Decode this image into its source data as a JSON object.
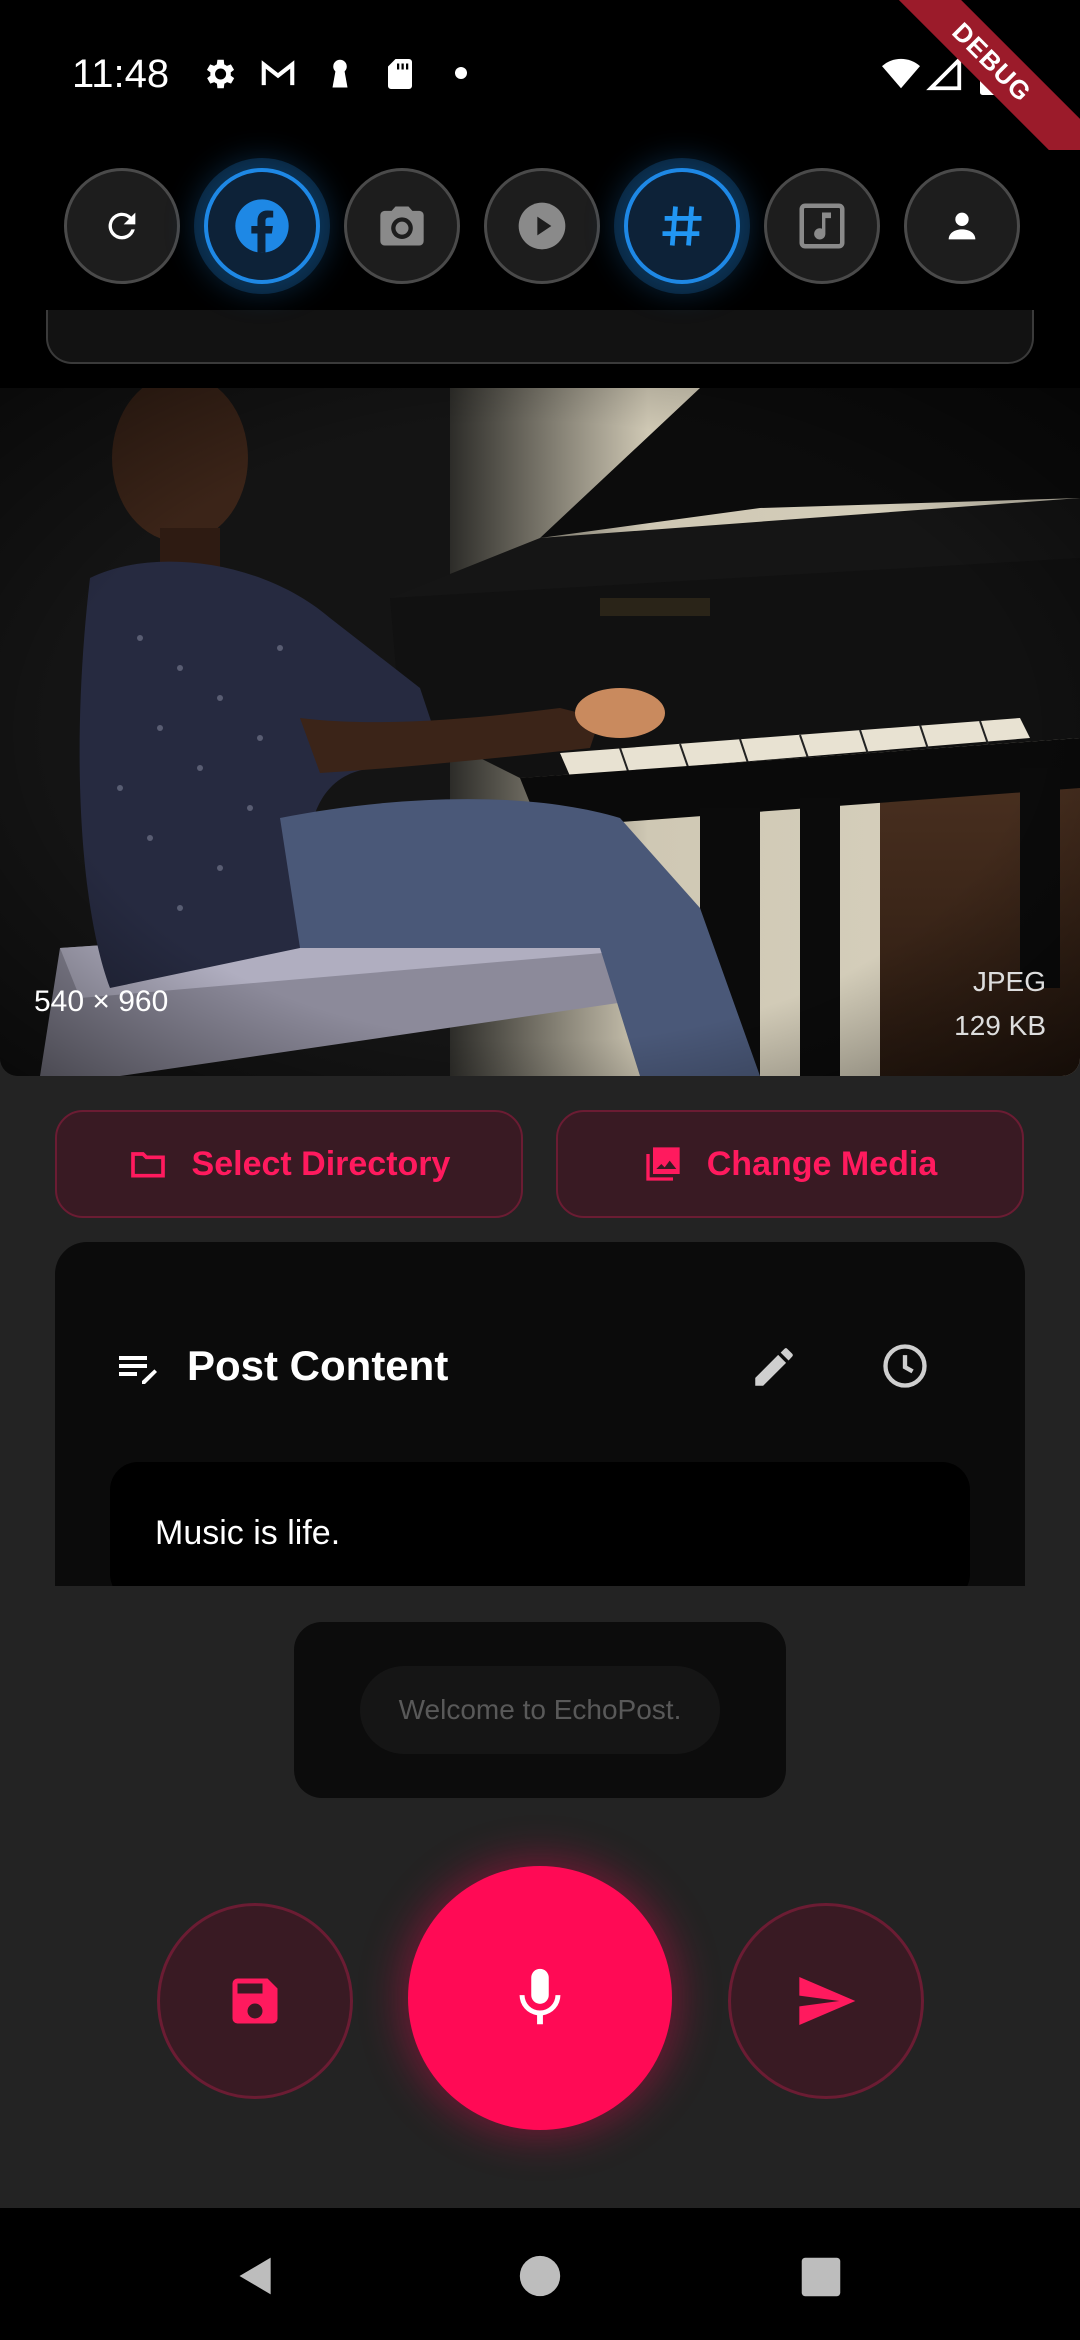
{
  "status_bar": {
    "time": "11:48",
    "debug_label": "DEBUG"
  },
  "platforms": [
    {
      "name": "refresh",
      "active": false
    },
    {
      "name": "facebook",
      "active": true
    },
    {
      "name": "camera",
      "active": false
    },
    {
      "name": "video",
      "active": false
    },
    {
      "name": "hashtag",
      "active": true
    },
    {
      "name": "music",
      "active": false
    },
    {
      "name": "profile",
      "active": false
    }
  ],
  "media": {
    "dimensions": "540 × 960",
    "type": "JPEG",
    "size": "129 KB"
  },
  "actions": {
    "select_directory": "Select Directory",
    "change_media": "Change Media"
  },
  "post": {
    "title": "Post Content",
    "text": "Music is life."
  },
  "toast": {
    "message": "Welcome to EchoPost."
  },
  "colors": {
    "accent": "#ff0a55",
    "active_blue": "#1e88e5",
    "background": "#232323"
  }
}
